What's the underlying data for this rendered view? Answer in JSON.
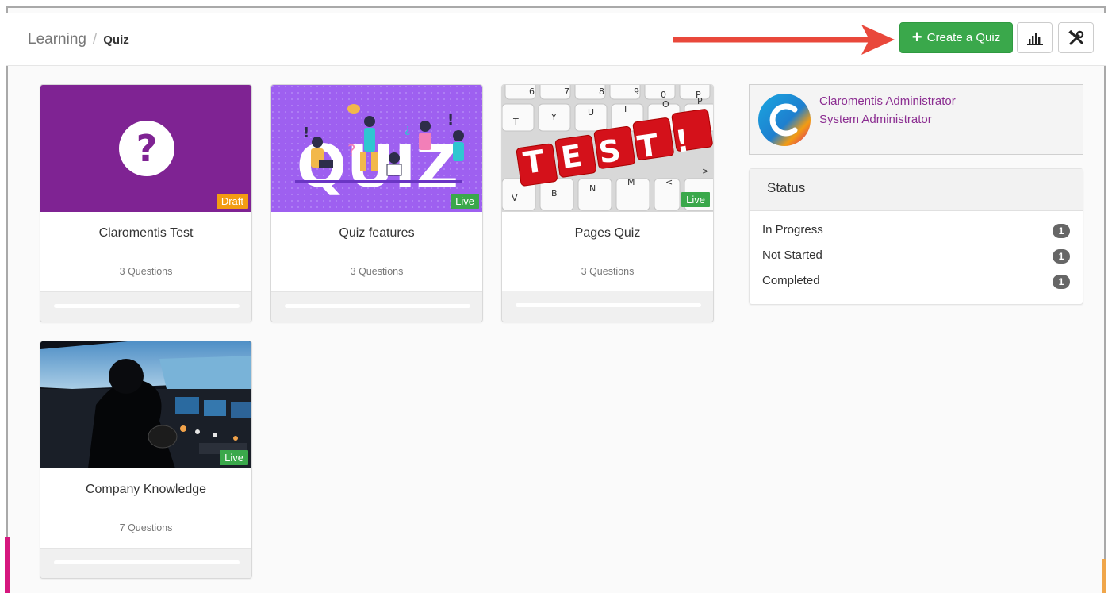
{
  "breadcrumb": {
    "root": "Learning",
    "separator": "/",
    "current": "Quiz"
  },
  "toolbar": {
    "create_label": "Create a Quiz",
    "create_icon": "plus-icon",
    "stats_icon": "bar-chart-icon",
    "tools_icon": "tools-icon"
  },
  "colors": {
    "accent_green": "#3aa84b",
    "draft": "#f39c12",
    "live": "#3aa84b",
    "brand_purple": "#8b2d91",
    "arrow": "#e9483b"
  },
  "quizzes": [
    {
      "title": "Claromentis Test",
      "questions": "3 Questions",
      "status": "Draft",
      "thumb": "question-icon"
    },
    {
      "title": "Quiz features",
      "questions": "3 Questions",
      "status": "Live",
      "thumb": "quiz-illustration"
    },
    {
      "title": "Pages Quiz",
      "questions": "3 Questions",
      "status": "Live",
      "thumb": "keyboard-test-image"
    },
    {
      "title": "Company Knowledge",
      "questions": "7 Questions",
      "status": "Live",
      "thumb": "cockpit-photo"
    }
  ],
  "profile": {
    "name": "Claromentis Administrator",
    "role": "System Administrator",
    "avatar_letter": "C"
  },
  "status": {
    "title": "Status",
    "rows": [
      {
        "label": "In Progress",
        "count": "1"
      },
      {
        "label": "Not Started",
        "count": "1"
      },
      {
        "label": "Completed",
        "count": "1"
      }
    ]
  },
  "thumb_text": {
    "quiz_word": "QUIZ",
    "test_word": "TEST!",
    "keys_top": [
      "6",
      "7",
      "8",
      "9",
      "0",
      "P"
    ],
    "keys_mid": [
      "T",
      "Y",
      "U",
      "I",
      "O",
      "P"
    ],
    "keys_bottom": [
      "V",
      "B",
      "N",
      "M",
      "<",
      ">"
    ]
  }
}
